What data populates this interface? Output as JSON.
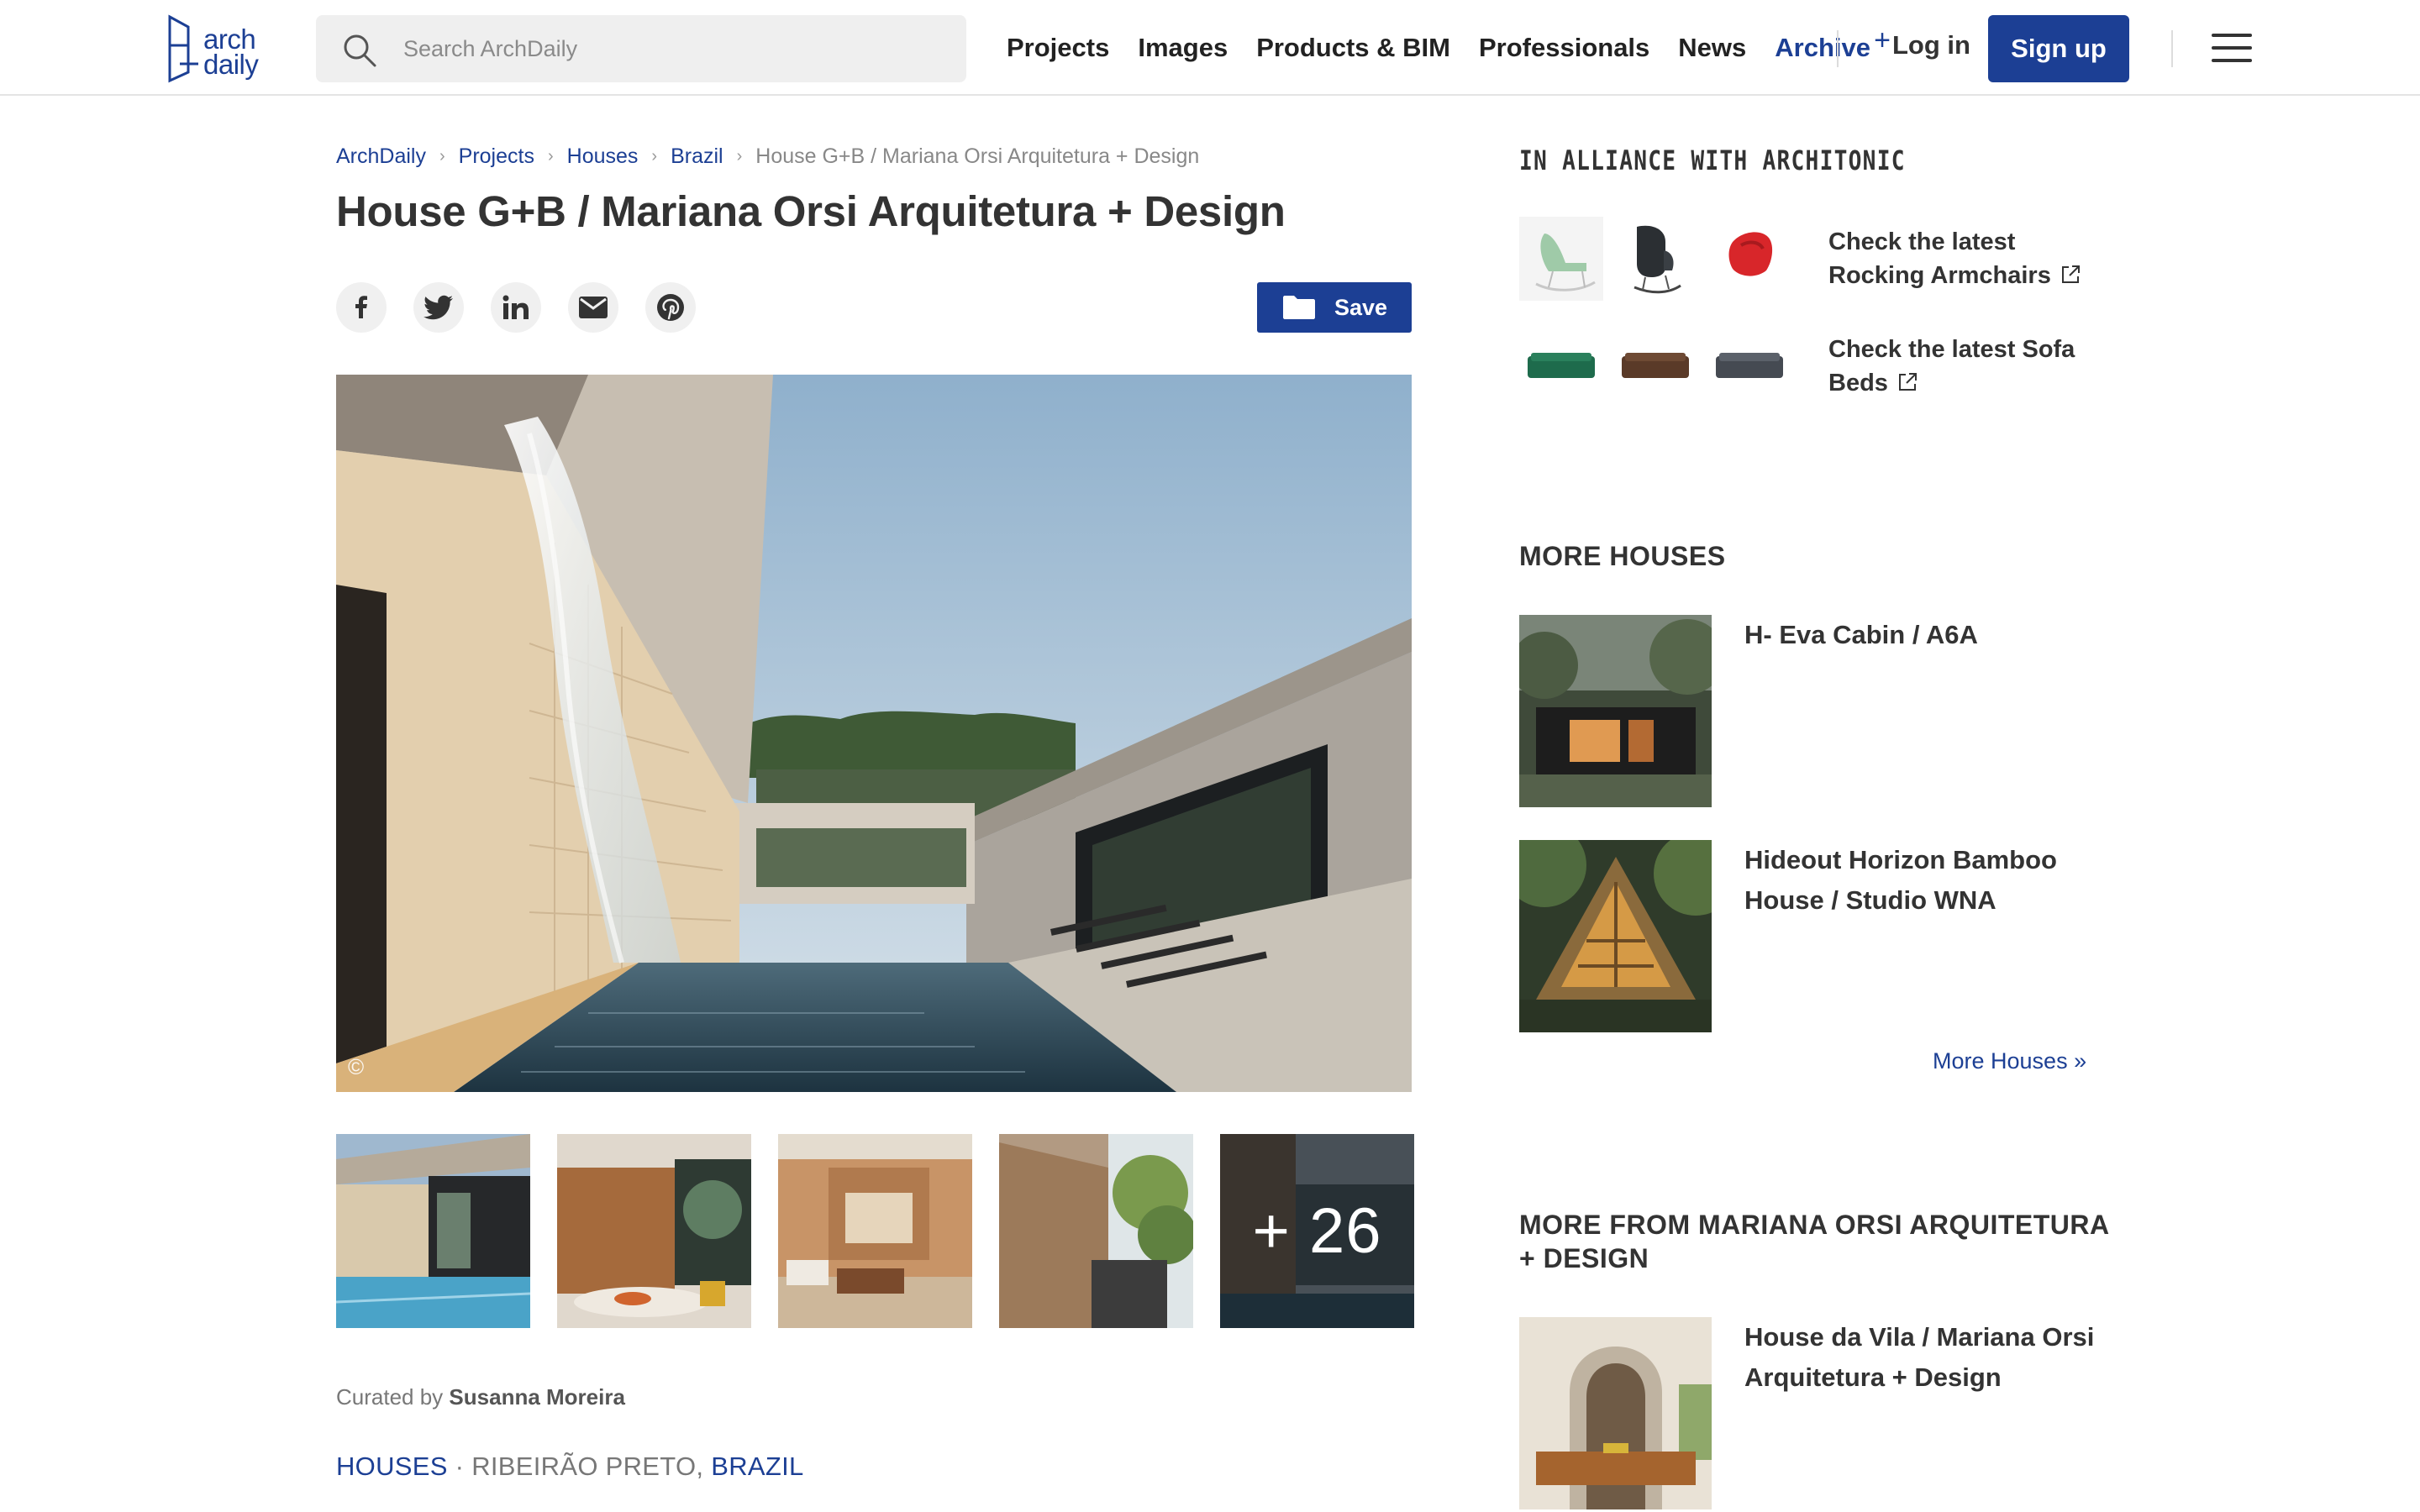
{
  "header": {
    "logo_line1": "arch",
    "logo_line2": "daily",
    "search_placeholder": "Search ArchDaily",
    "nav": [
      "Projects",
      "Images",
      "Products & BIM",
      "Professionals",
      "News"
    ],
    "archive_label": "Archive",
    "archive_plus": "+",
    "login_label": "Log in",
    "signup_label": "Sign up",
    "accent_color": "#1c3f94"
  },
  "breadcrumb": [
    "ArchDaily",
    "Projects",
    "Houses",
    "Brazil"
  ],
  "breadcrumb_current": "House G+B / Mariana Orsi Arquitetura + Design",
  "title": "House G+B / Mariana Orsi Arquitetura + Design",
  "share_icons": [
    "facebook-icon",
    "twitter-icon",
    "linkedin-icon",
    "email-icon",
    "pinterest-icon"
  ],
  "save_label": "Save",
  "hero": {
    "copyright_symbol": "©"
  },
  "gallery": {
    "more_count": "+ 26"
  },
  "curated": {
    "prefix": "Curated by",
    "name": "Susanna Moreira"
  },
  "tags": {
    "category": "HOUSES",
    "separator": "·",
    "city": "RIBEIRÃO PRETO,",
    "country": "BRAZIL"
  },
  "sidebar": {
    "alliance_title": "IN ALLIANCE WITH ARCHITONIC",
    "alliance_links": [
      {
        "label": "Check the latest Rocking Armchairs"
      },
      {
        "label": "Check the latest Sofa Beds"
      }
    ],
    "more_houses_title": "MORE HOUSES",
    "more_houses": [
      {
        "title": "H- Eva Cabin / A6A"
      },
      {
        "title": "Hideout Horizon Bamboo House / Studio WNA"
      }
    ],
    "more_houses_link": "More Houses »",
    "more_from_title": "MORE FROM MARIANA ORSI ARQUITETURA + DESIGN",
    "more_from": [
      {
        "title": "House da Vila / Mariana Orsi Arquitetura + Design"
      }
    ]
  }
}
